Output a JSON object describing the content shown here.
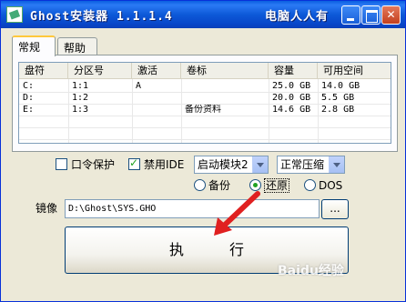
{
  "window": {
    "title": "Ghost安装器 1.1.1.4",
    "watermark_title": "电脑人人有"
  },
  "tabs": [
    {
      "label": "常规",
      "active": true
    },
    {
      "label": "帮助",
      "active": false
    }
  ],
  "partitions": {
    "columns": [
      "盘符",
      "分区号",
      "激活",
      "卷标",
      "容量",
      "可用空间"
    ],
    "rows": [
      [
        "C:",
        "1:1",
        "A",
        "",
        "25.0 GB",
        "14.0 GB"
      ],
      [
        "D:",
        "1:2",
        "",
        "",
        "20.0 GB",
        "5.5 GB"
      ],
      [
        "E:",
        "1:3",
        "",
        "备份资料",
        "14.6 GB",
        "2.8 GB"
      ]
    ]
  },
  "options": {
    "password_label": "口令保护",
    "password_checked": false,
    "disable_ide_label": "禁用IDE",
    "disable_ide_checked": true,
    "boot_module": "启动模块2",
    "compression": "正常压缩"
  },
  "mode": {
    "options": [
      "备份",
      "还原",
      "DOS"
    ],
    "selected": "还原"
  },
  "image": {
    "label": "镜像",
    "path": "D:\\Ghost\\SYS.GHO",
    "browse_label": "..."
  },
  "execute": {
    "label": "执行"
  },
  "watermark": "Baidu经验",
  "colors": {
    "titlebar": "#0a5fe0",
    "face": "#ece9d8",
    "check": "#21a121",
    "arrow": "#e02020"
  }
}
